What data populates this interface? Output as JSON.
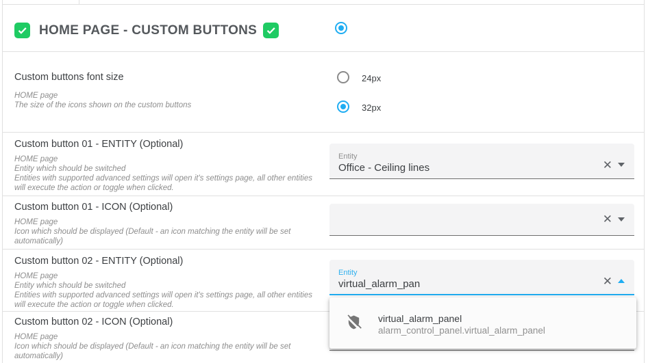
{
  "colors": {
    "green": "#1fcb63",
    "blue": "#1fadf2"
  },
  "header": {
    "title": "HOME PAGE - CUSTOM BUTTONS"
  },
  "font_size": {
    "title": "Custom buttons font size",
    "desc_lines": [
      "HOME page",
      "The size of the icons shown on the custom buttons"
    ],
    "options": [
      {
        "label": "24px",
        "selected": false
      },
      {
        "label": "32px",
        "selected": true
      }
    ]
  },
  "button01_entity": {
    "title": "Custom button 01 - ENTITY (Optional)",
    "desc_lines": [
      "HOME page",
      "Entity which should be switched",
      "Entities with supported advanced settings will open it's settings page, all other entities will execute the action or toggle when clicked."
    ],
    "field": {
      "label": "Entity",
      "value": "Office - Ceiling lines"
    }
  },
  "button01_icon": {
    "title": "Custom button 01 - ICON (Optional)",
    "desc_lines": [
      "HOME page",
      "Icon which should be displayed (Default - an icon matching the entity will be set automatically)"
    ],
    "field": {
      "label": "",
      "value": ""
    }
  },
  "button02_entity": {
    "title": "Custom button 02 - ENTITY (Optional)",
    "desc_lines": [
      "HOME page",
      "Entity which should be switched",
      "Entities with supported advanced settings will open it's settings page, all other entities will execute the action or toggle when clicked."
    ],
    "field": {
      "label": "Entity",
      "value": "virtual_alarm_pan"
    },
    "dropdown": {
      "items": [
        {
          "icon": "shield-off-icon",
          "title": "virtual_alarm_panel",
          "subtitle": "alarm_control_panel.virtual_alarm_panel"
        }
      ]
    }
  },
  "button02_icon": {
    "title": "Custom button 02 - ICON (Optional)",
    "desc_lines": [
      "HOME page",
      "Icon which should be displayed (Default - an icon matching the entity will be set automatically)"
    ]
  }
}
